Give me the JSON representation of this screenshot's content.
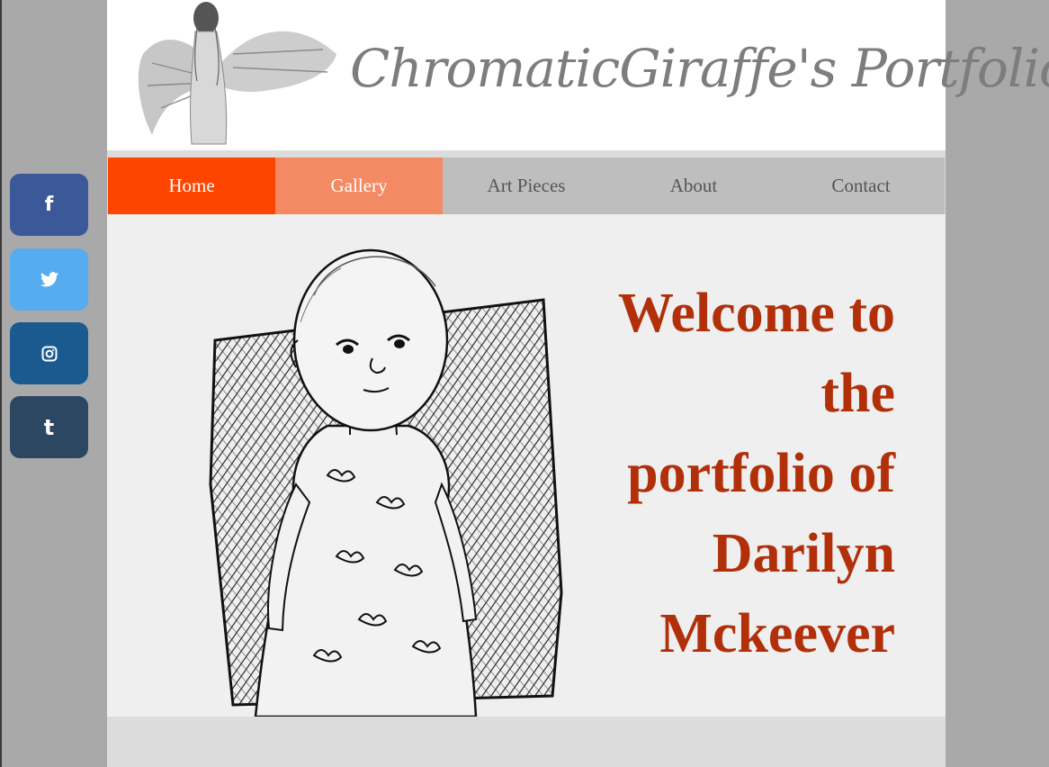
{
  "site": {
    "title": "ChromaticGiraffe's Portfolio",
    "logo_icon": "winged-figure-sketch"
  },
  "nav": {
    "items": [
      {
        "label": "Home",
        "state": "active"
      },
      {
        "label": "Gallery",
        "state": "hover"
      },
      {
        "label": "Art Pieces",
        "state": "default"
      },
      {
        "label": "About",
        "state": "default"
      },
      {
        "label": "Contact",
        "state": "default"
      }
    ]
  },
  "social": [
    {
      "icon": "facebook-icon",
      "glyph": "f",
      "color": "#3b5998"
    },
    {
      "icon": "twitter-icon",
      "glyph": "",
      "color": "#55acee"
    },
    {
      "icon": "instagram-icon",
      "glyph": "",
      "color": "#1a5a8e"
    },
    {
      "icon": "tumblr-icon",
      "glyph": "t",
      "color": "#2c4762"
    }
  ],
  "hero": {
    "welcome_lines": [
      "Welcome to",
      "the",
      "portfolio of",
      "Darilyn",
      "Mckeever"
    ],
    "image": "pen-sketch-of-toddler"
  },
  "colors": {
    "accent": "#fe4500",
    "hover": "#f38a64",
    "nav_bg": "#bebebe",
    "welcome_text": "#b1300a"
  }
}
